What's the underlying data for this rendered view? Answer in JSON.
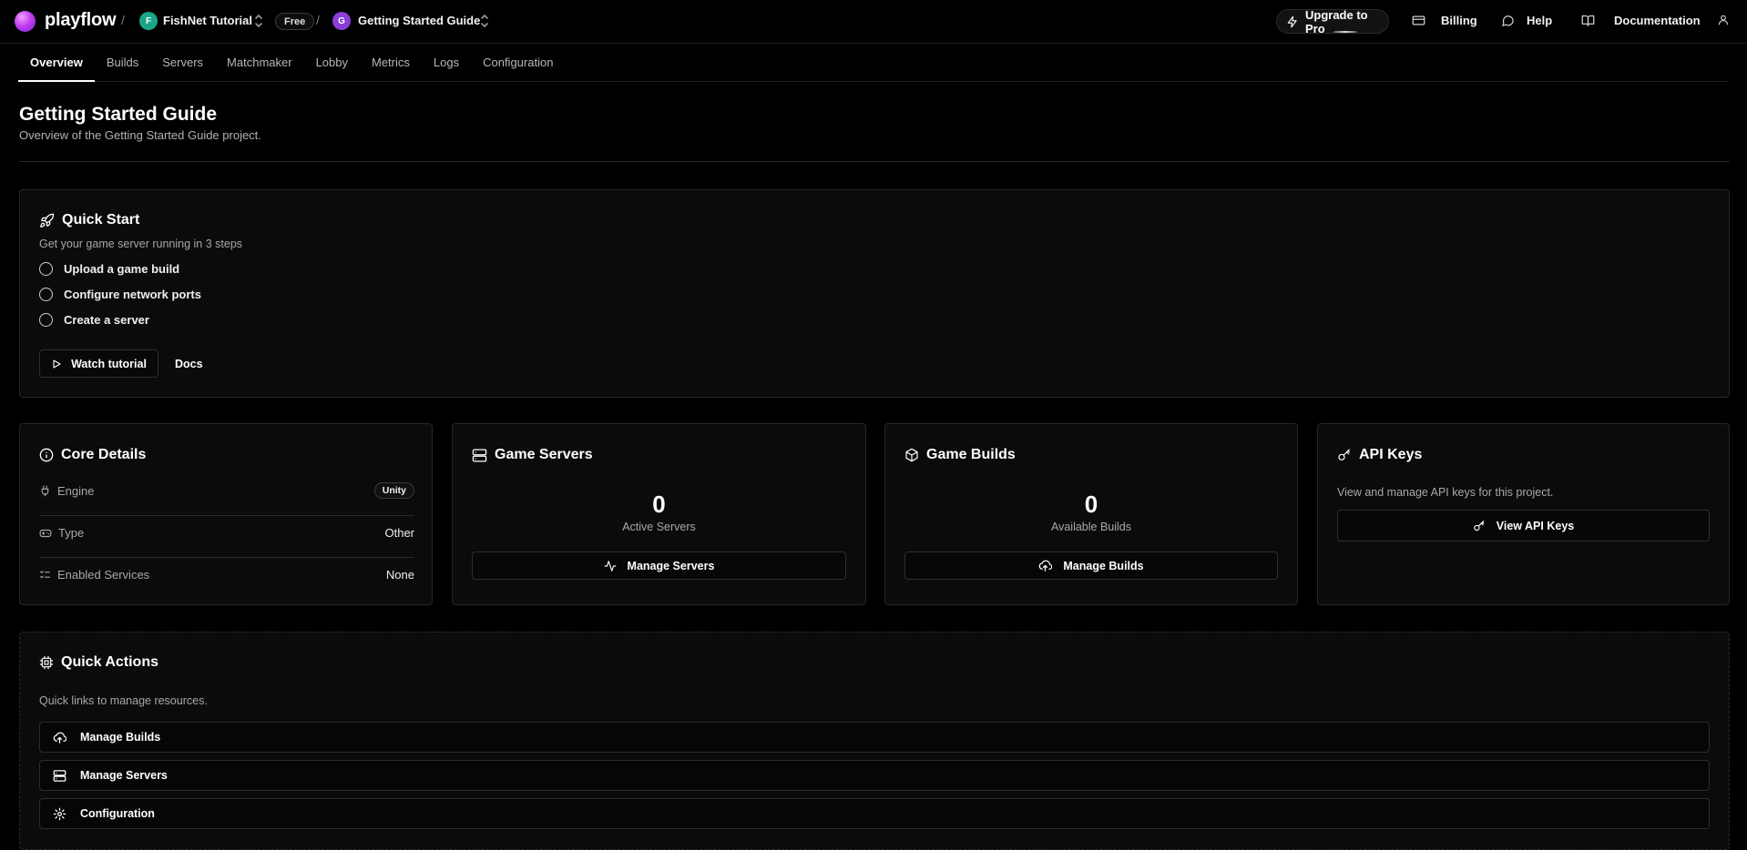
{
  "app": {
    "brand": "playflow"
  },
  "breadcrumb": {
    "workspace_initial": "F",
    "workspace_name": "FishNet Tutorial",
    "plan_badge": "Free",
    "project_initial": "G",
    "project_name": "Getting Started Guide",
    "separator": "/"
  },
  "topnav": {
    "upgrade": "Upgrade to Pro",
    "billing": "Billing",
    "help": "Help",
    "documentation": "Documentation"
  },
  "tabs": [
    "Overview",
    "Builds",
    "Servers",
    "Matchmaker",
    "Lobby",
    "Metrics",
    "Logs",
    "Configuration"
  ],
  "header": {
    "title": "Getting Started Guide",
    "subtitle": "Overview of the Getting Started Guide project."
  },
  "quick_start": {
    "title": "Quick Start",
    "subtitle": "Get your game server running in 3 steps",
    "steps": [
      "Upload a game build",
      "Configure network ports",
      "Create a server"
    ],
    "watch_tutorial": "Watch tutorial",
    "docs": "Docs"
  },
  "core_details": {
    "title": "Core Details",
    "engine_label": "Engine",
    "engine_value": "Unity",
    "type_label": "Type",
    "type_value": "Other",
    "services_label": "Enabled Services",
    "services_value": "None"
  },
  "game_servers": {
    "title": "Game Servers",
    "count": "0",
    "count_label": "Active Servers",
    "button": "Manage Servers"
  },
  "game_builds": {
    "title": "Game Builds",
    "count": "0",
    "count_label": "Available Builds",
    "button": "Manage Builds"
  },
  "api_keys": {
    "title": "API Keys",
    "description": "View and manage API keys for this project.",
    "button": "View API Keys"
  },
  "quick_actions": {
    "title": "Quick Actions",
    "subtitle": "Quick links to manage resources.",
    "items": [
      "Manage Builds",
      "Manage Servers",
      "Configuration"
    ]
  },
  "colors": {
    "background": "#000000",
    "card": "#0b0b0b",
    "workspace_avatar": "#1aa58a",
    "project_avatar": "#8b3fd6",
    "logo": "#c43ff0"
  }
}
